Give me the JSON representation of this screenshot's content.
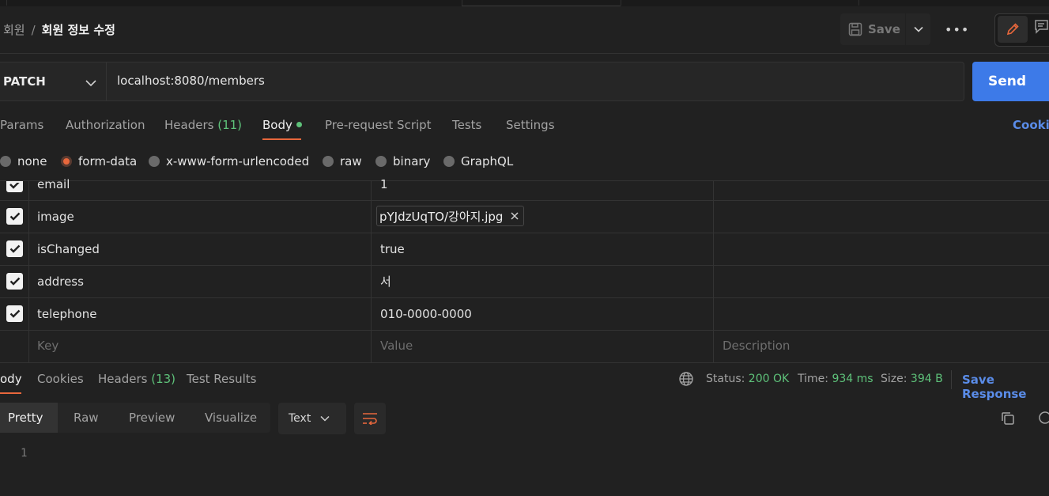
{
  "breadcrumb": {
    "parent": "회원",
    "separator": "/",
    "current": "회원 정보 수정"
  },
  "header": {
    "save_label": "Save",
    "more_label": "•••"
  },
  "request": {
    "method": "PATCH",
    "url": "localhost:8080/members",
    "send_label": "Send"
  },
  "tabs": {
    "params": "Params",
    "authorization": "Authorization",
    "headers": "Headers",
    "headers_count": "(11)",
    "body": "Body",
    "prerequest": "Pre-request Script",
    "tests": "Tests",
    "settings": "Settings",
    "cookies": "Cookies"
  },
  "body_types": [
    "none",
    "form-data",
    "x-www-form-urlencoded",
    "raw",
    "binary",
    "GraphQL"
  ],
  "body_type_selected": "form-data",
  "form_rows": [
    {
      "key": "email",
      "value": "1",
      "checked": true
    },
    {
      "key": "image",
      "value": "pYJdzUqTO/강아지.jpg",
      "checked": true,
      "is_file": true
    },
    {
      "key": "isChanged",
      "value": "true",
      "checked": true
    },
    {
      "key": "address",
      "value": "서",
      "checked": true
    },
    {
      "key": "telephone",
      "value": "010-0000-0000",
      "checked": true
    }
  ],
  "form_placeholders": {
    "key": "Key",
    "value": "Value",
    "description": "Description"
  },
  "response": {
    "tabs": {
      "body": "ody",
      "cookies": "Cookies",
      "headers": "Headers",
      "headers_count": "(13)",
      "test_results": "Test Results"
    },
    "status_label": "Status:",
    "status_value": "200 OK",
    "time_label": "Time:",
    "time_value": "934 ms",
    "size_label": "Size:",
    "size_value": "394 B",
    "save_response": "Save Response",
    "formats": [
      "Pretty",
      "Raw",
      "Preview",
      "Visualize"
    ],
    "format_selected": "Pretty",
    "text_type": "Text",
    "line_number": "1"
  },
  "colors": {
    "accent": "#e8673c",
    "send": "#3d7ae8",
    "link": "#5a8ce8",
    "success": "#5ec27a",
    "background": "#212121"
  }
}
